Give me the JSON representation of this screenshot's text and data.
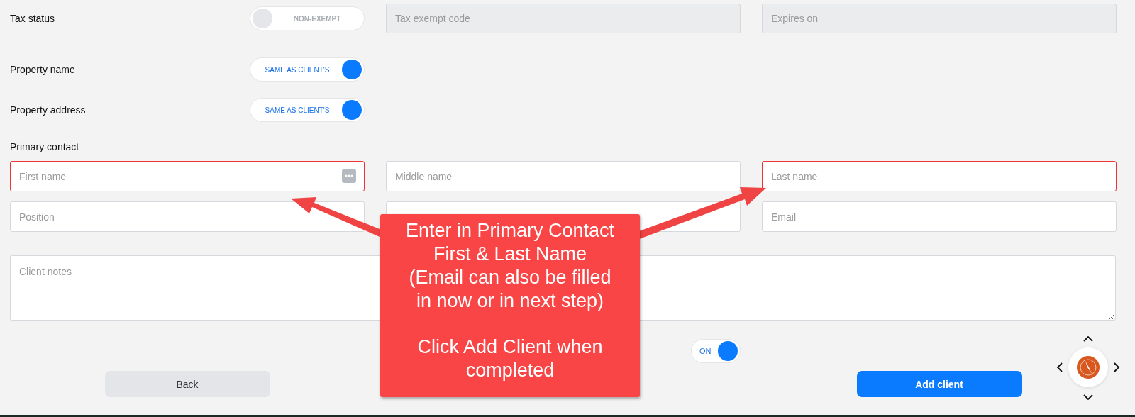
{
  "tax_status": {
    "label": "Tax status",
    "toggle": {
      "text": "NON-EXEMPT",
      "on": false
    },
    "fields": [
      {
        "placeholder": "Tax exempt code",
        "disabled": true
      },
      {
        "placeholder": "Expires on",
        "disabled": true
      }
    ]
  },
  "property_rows": [
    {
      "label": "Property name",
      "toggle": {
        "text": "SAME AS CLIENT'S",
        "on": true
      }
    },
    {
      "label": "Property address",
      "toggle": {
        "text": "SAME AS CLIENT'S",
        "on": true
      }
    }
  ],
  "primary_contact": {
    "label": "Primary contact",
    "fields": [
      {
        "placeholder": "First name",
        "error": true,
        "autofill_icon": true
      },
      {
        "placeholder": "Middle name",
        "error": false
      },
      {
        "placeholder": "Last name",
        "error": true
      },
      {
        "placeholder": "Position",
        "error": false
      },
      {
        "error": false
      },
      {
        "placeholder": "Email",
        "error": false
      }
    ]
  },
  "client_notes": {
    "placeholder": "Client notes"
  },
  "toggle": {
    "text": "ON",
    "on": true
  },
  "buttons": [
    {
      "label": "Back",
      "kind": "secondary"
    },
    {
      "label": "Add client",
      "kind": "primary"
    }
  ],
  "callout": {
    "paragraphs": [
      [
        "Enter in Primary Contact",
        "First & Last Name",
        "(Email can also be filled",
        "in now or in next step)"
      ],
      [
        "Click Add Client when",
        "completed"
      ]
    ]
  }
}
